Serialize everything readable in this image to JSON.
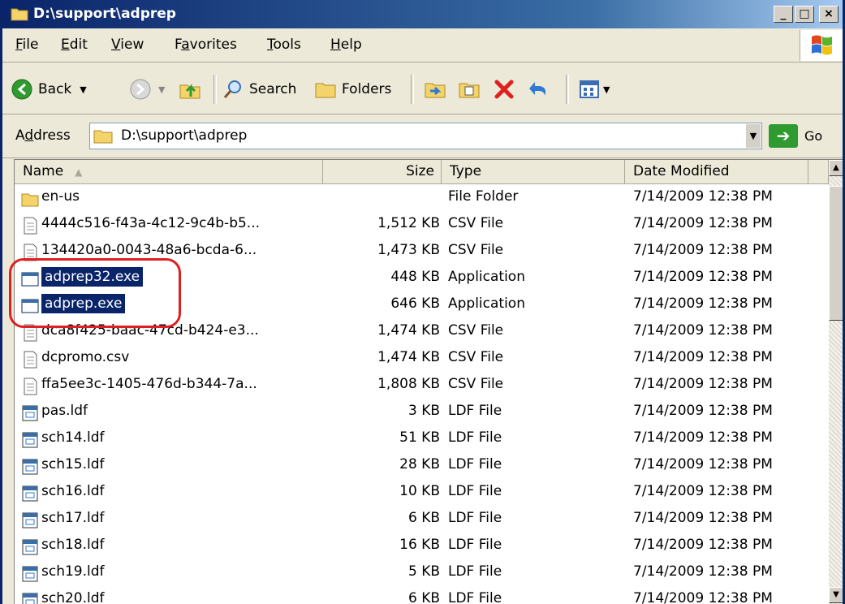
{
  "window": {
    "title": "D:\\support\\adprep",
    "min_label": "_",
    "max_label": "□",
    "close_label": "×"
  },
  "menu": [
    {
      "first": "F",
      "rest": "ile"
    },
    {
      "first": "E",
      "rest": "dit"
    },
    {
      "first": "V",
      "rest": "iew"
    },
    {
      "pre": "F",
      "first": "a",
      "rest": "vorites"
    },
    {
      "first": "T",
      "rest": "ools"
    },
    {
      "first": "H",
      "rest": "elp"
    }
  ],
  "toolbar": {
    "back": "Back",
    "search": "Search",
    "folders": "Folders"
  },
  "address": {
    "label_pre": "A",
    "label_u": "d",
    "label_post": "dress",
    "value": "D:\\support\\adprep",
    "go": "Go"
  },
  "columns": {
    "name": "Name",
    "size": "Size",
    "type": "Type",
    "date": "Date Modified"
  },
  "files": [
    {
      "name": "en-us",
      "size": "",
      "type": "File Folder",
      "date": "7/14/2009 12:38 PM",
      "icon": "folder-icon"
    },
    {
      "name": "4444c516-f43a-4c12-9c4b-b5...",
      "size": "1,512 KB",
      "type": "CSV File",
      "date": "7/14/2009 12:38 PM",
      "icon": "csv-file-icon"
    },
    {
      "name": "134420a0-0043-48a6-bcda-6...",
      "size": "1,473 KB",
      "type": "CSV File",
      "date": "7/14/2009 12:38 PM",
      "icon": "csv-file-icon"
    },
    {
      "name": "adprep32.exe",
      "size": "448 KB",
      "type": "Application",
      "date": "7/14/2009 12:38 PM",
      "icon": "application-icon",
      "selected": true
    },
    {
      "name": "adprep.exe",
      "size": "646 KB",
      "type": "Application",
      "date": "7/14/2009 12:38 PM",
      "icon": "application-icon",
      "selected": true
    },
    {
      "name": "dca8f425-baac-47cd-b424-e3...",
      "size": "1,474 KB",
      "type": "CSV File",
      "date": "7/14/2009 12:38 PM",
      "icon": "csv-file-icon"
    },
    {
      "name": "dcpromo.csv",
      "size": "1,474 KB",
      "type": "CSV File",
      "date": "7/14/2009 12:38 PM",
      "icon": "csv-file-icon"
    },
    {
      "name": "ffa5ee3c-1405-476d-b344-7a...",
      "size": "1,808 KB",
      "type": "CSV File",
      "date": "7/14/2009 12:38 PM",
      "icon": "csv-file-icon"
    },
    {
      "name": "pas.ldf",
      "size": "3 KB",
      "type": "LDF File",
      "date": "7/14/2009 12:38 PM",
      "icon": "ldf-file-icon"
    },
    {
      "name": "sch14.ldf",
      "size": "51 KB",
      "type": "LDF File",
      "date": "7/14/2009 12:38 PM",
      "icon": "ldf-file-icon"
    },
    {
      "name": "sch15.ldf",
      "size": "28 KB",
      "type": "LDF File",
      "date": "7/14/2009 12:38 PM",
      "icon": "ldf-file-icon"
    },
    {
      "name": "sch16.ldf",
      "size": "10 KB",
      "type": "LDF File",
      "date": "7/14/2009 12:38 PM",
      "icon": "ldf-file-icon"
    },
    {
      "name": "sch17.ldf",
      "size": "6 KB",
      "type": "LDF File",
      "date": "7/14/2009 12:38 PM",
      "icon": "ldf-file-icon"
    },
    {
      "name": "sch18.ldf",
      "size": "16 KB",
      "type": "LDF File",
      "date": "7/14/2009 12:38 PM",
      "icon": "ldf-file-icon"
    },
    {
      "name": "sch19.ldf",
      "size": "5 KB",
      "type": "LDF File",
      "date": "7/14/2009 12:38 PM",
      "icon": "ldf-file-icon"
    },
    {
      "name": "sch20.ldf",
      "size": "6 KB",
      "type": "LDF File",
      "date": "7/14/2009 12:38 PM",
      "icon": "ldf-file-icon"
    }
  ]
}
